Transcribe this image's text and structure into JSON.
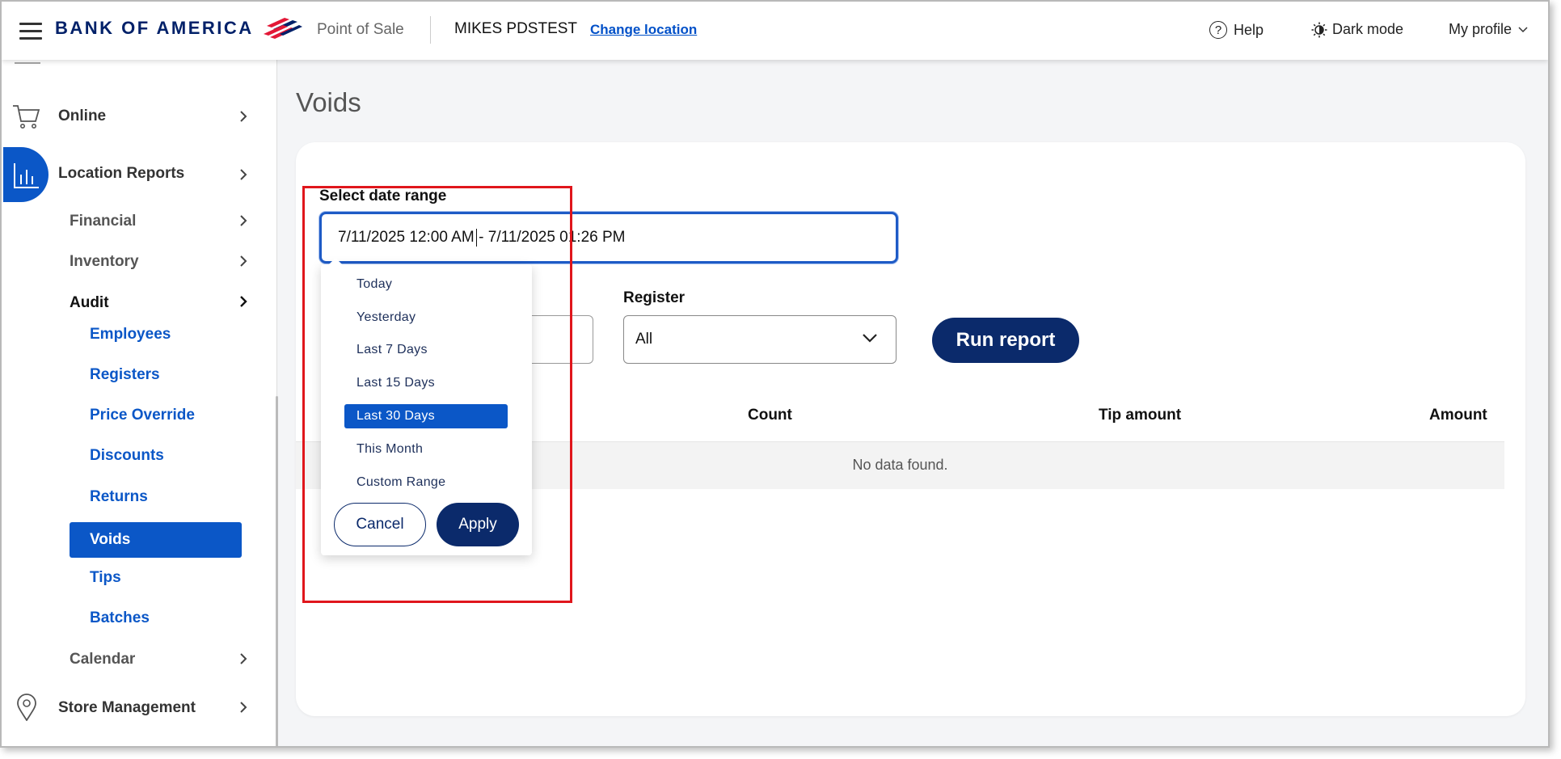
{
  "header": {
    "brand": "BANK OF AMERICA",
    "app_name": "Point of Sale",
    "store_name": "MIKES PDSTEST",
    "change_location": "Change location",
    "help": "Help",
    "dark_mode": "Dark mode",
    "profile": "My profile"
  },
  "sidebar": {
    "online": "Online",
    "location_reports": "Location Reports",
    "financial": "Financial",
    "inventory": "Inventory",
    "audit": "Audit",
    "audit_items": [
      "Employees",
      "Registers",
      "Price Override",
      "Discounts",
      "Returns",
      "Voids",
      "Tips",
      "Batches"
    ],
    "calendar": "Calendar",
    "store_management": "Store Management"
  },
  "main": {
    "title": "Voids",
    "date_label": "Select date range",
    "date_start": "7/11/2025 12:00 AM",
    "date_end": "- 7/11/2025 01:26 PM",
    "register_label": "Register",
    "register_value": "All",
    "run_report": "Run report",
    "columns": [
      "Count",
      "Tip amount",
      "Amount"
    ],
    "no_data": "No data found."
  },
  "dropdown": {
    "options": [
      "Today",
      "Yesterday",
      "Last 7 Days",
      "Last 15 Days",
      "Last 30 Days",
      "This Month",
      "Custom Range"
    ],
    "selected": "Last 30 Days",
    "cancel": "Cancel",
    "apply": "Apply"
  },
  "colors": {
    "brand_navy": "#012169",
    "primary_blue": "#0b57c7",
    "button_navy": "#0b2a6b",
    "highlight_red": "#e0161c"
  }
}
